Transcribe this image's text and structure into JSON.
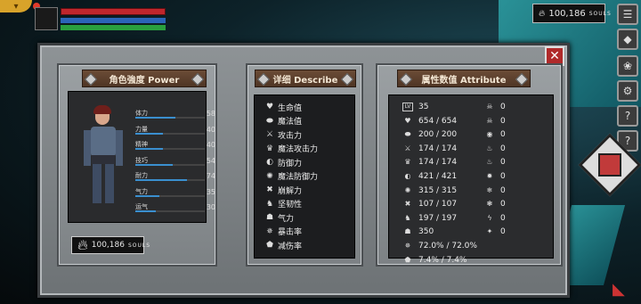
{
  "hud": {
    "corner_icon": "chevron-down-icon",
    "souls_value": "100,186",
    "souls_unit": "SOULS"
  },
  "side_buttons": [
    {
      "name": "menu-button",
      "icon": "☰"
    },
    {
      "name": "map-button",
      "icon": "◆"
    },
    {
      "name": "skill-button",
      "icon": "❀"
    },
    {
      "name": "settings-button",
      "icon": "⚙"
    },
    {
      "name": "help-button",
      "icon": "?"
    }
  ],
  "close_icon": "✕",
  "power": {
    "title": "角色強度 Power",
    "stats": [
      {
        "label": "体力",
        "value": "58",
        "fill": 0.58
      },
      {
        "label": "力量",
        "value": "40",
        "fill": 0.4
      },
      {
        "label": "精神",
        "value": "40",
        "fill": 0.4
      },
      {
        "label": "技巧",
        "value": "54",
        "fill": 0.54
      },
      {
        "label": "耐力",
        "value": "74",
        "fill": 0.74
      },
      {
        "label": "气力",
        "value": "35",
        "fill": 0.35
      },
      {
        "label": "运气",
        "value": "30",
        "fill": 0.3
      }
    ],
    "souls_value": "100,186",
    "souls_unit": "SOULS"
  },
  "describe": {
    "title": "详细 Describe",
    "items": [
      {
        "icon": "♥",
        "label": "生命值"
      },
      {
        "icon": "⬬",
        "label": "魔法值"
      },
      {
        "icon": "⚔",
        "label": "攻击力"
      },
      {
        "icon": "♛",
        "label": "魔法攻击力"
      },
      {
        "icon": "◐",
        "label": "防御力"
      },
      {
        "icon": "✺",
        "label": "魔法防御力"
      },
      {
        "icon": "✖",
        "label": "崩解力"
      },
      {
        "icon": "♞",
        "label": "坚韧性"
      },
      {
        "icon": "☗",
        "label": "气力"
      },
      {
        "icon": "✵",
        "label": "暴击率"
      },
      {
        "icon": "⬟",
        "label": "减伤率"
      }
    ]
  },
  "attribute": {
    "title": "属性数值 Attribute",
    "rows": [
      {
        "icon": "LV",
        "value": "35",
        "ricon": "☠",
        "rvalue": "0"
      },
      {
        "icon": "♥",
        "value": "654 / 654",
        "ricon": "☠",
        "rvalue": "0"
      },
      {
        "icon": "⬬",
        "value": "200 / 200",
        "ricon": "◉",
        "rvalue": "0"
      },
      {
        "icon": "⚔",
        "value": "174 / 174",
        "ricon": "♨",
        "rvalue": "0"
      },
      {
        "icon": "♛",
        "value": "174 / 174",
        "ricon": "♨",
        "rvalue": "0"
      },
      {
        "icon": "◐",
        "value": "421 / 421",
        "ricon": "✹",
        "rvalue": "0"
      },
      {
        "icon": "✺",
        "value": "315 / 315",
        "ricon": "❄",
        "rvalue": "0"
      },
      {
        "icon": "✖",
        "value": "107 / 107",
        "ricon": "❃",
        "rvalue": "0"
      },
      {
        "icon": "♞",
        "value": "197 / 197",
        "ricon": "ϟ",
        "rvalue": "0"
      },
      {
        "icon": "☗",
        "value": "350",
        "ricon": "✦",
        "rvalue": "0"
      },
      {
        "icon": "✵",
        "value": "72.0% / 72.0%"
      },
      {
        "icon": "⬟",
        "value": "7.4% / 7.4%"
      }
    ]
  }
}
